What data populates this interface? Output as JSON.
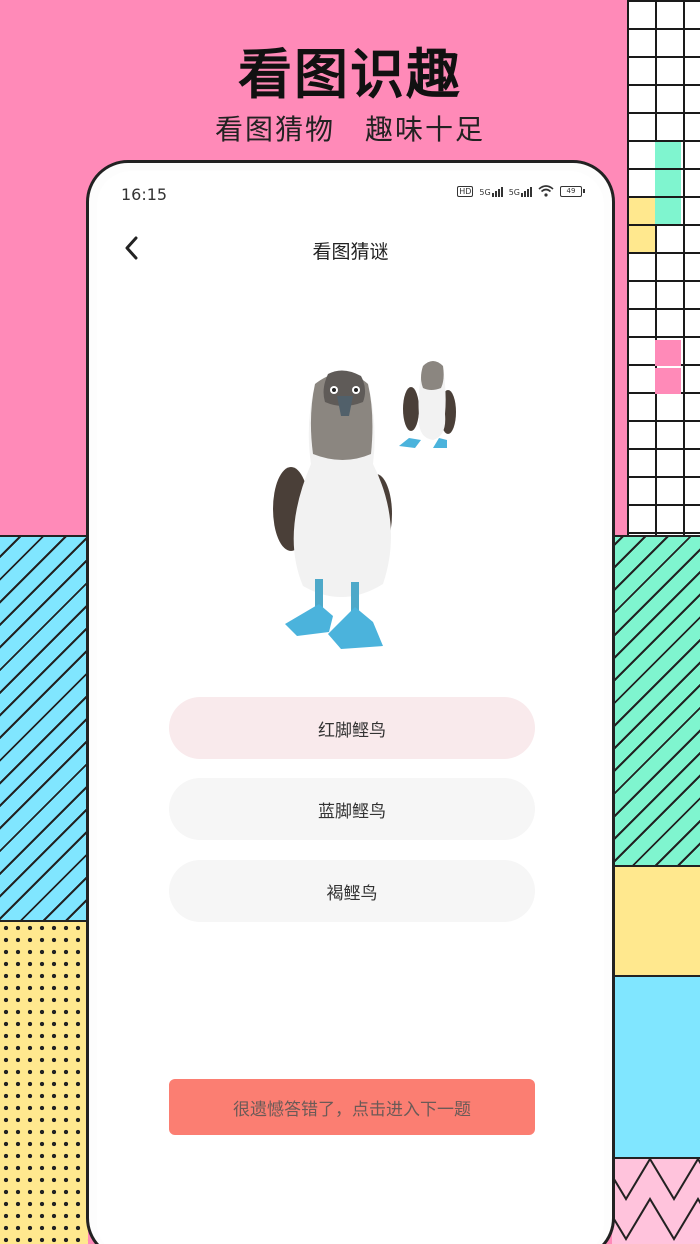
{
  "promo": {
    "headline": "看图识趣",
    "subline": "看图猜物　趣味十足"
  },
  "status_bar": {
    "time": "16:15",
    "hd_label": "HD",
    "net1": "5G",
    "net2": "5G",
    "battery": "49"
  },
  "nav": {
    "back_icon": "chevron-left-icon",
    "title": "看图猜谜"
  },
  "quiz": {
    "image_subject": "blue-footed booby birds",
    "options": [
      {
        "label": "红脚鲣鸟",
        "state": "wrong"
      },
      {
        "label": "蓝脚鲣鸟",
        "state": "default"
      },
      {
        "label": "褐鲣鸟",
        "state": "default"
      }
    ],
    "result_text": "很遗憾答错了，点击进入下一题"
  },
  "colors": {
    "background_pink": "#ff8ab8",
    "wrong_option_bg": "#f9eaec",
    "result_banner": "#fb7e72"
  }
}
